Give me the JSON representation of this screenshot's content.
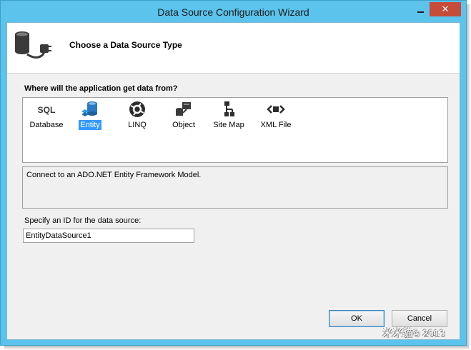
{
  "window": {
    "title": "Data Source Configuration Wizard",
    "close_glyph": "✕"
  },
  "header": {
    "title": "Choose a Data Source Type",
    "icon": "database-plug-icon"
  },
  "source_types": {
    "prompt": "Where will the application get data from?",
    "items": [
      {
        "label": "Database",
        "icon": "sql-icon",
        "selected": false
      },
      {
        "label": "Entity",
        "icon": "entity-database-icon",
        "selected": true
      },
      {
        "label": "LINQ",
        "icon": "linq-icon",
        "selected": false
      },
      {
        "label": "Object",
        "icon": "object-icon",
        "selected": false
      },
      {
        "label": "Site Map",
        "icon": "sitemap-icon",
        "selected": false
      },
      {
        "label": "XML File",
        "icon": "xml-icon",
        "selected": false
      }
    ],
    "description": "Connect to an ADO.NET Entity Framework Model."
  },
  "id_field": {
    "label": "Specify an ID for the data source:",
    "value": "EntityDataSource1"
  },
  "buttons": {
    "ok": "OK",
    "cancel": "Cancel"
  },
  "watermark": "米米貓© 2013",
  "colors": {
    "title_bar": "#5bc3ec",
    "close_button": "#c64b39",
    "selection": "#3399ff"
  }
}
